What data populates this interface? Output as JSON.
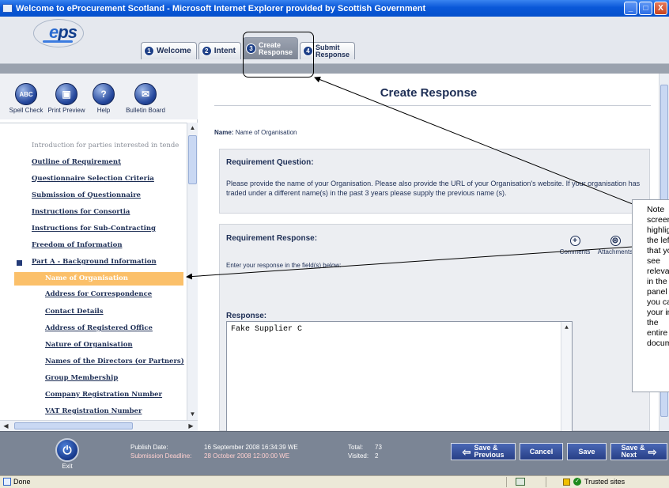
{
  "window": {
    "title": "Welcome to eProcurement Scotland - Microsoft Internet Explorer provided by Scottish Government",
    "controls": {
      "minimize": "_",
      "maximize": "□",
      "close": "X"
    }
  },
  "logo": {
    "text_a": "e",
    "text_b": "ps"
  },
  "tabs": [
    {
      "num": "1",
      "label": "Welcome"
    },
    {
      "num": "2",
      "label": "Intent"
    },
    {
      "num": "3",
      "line1": "Create",
      "line2": "Response"
    },
    {
      "num": "4",
      "line1": "Submit",
      "line2": "Response"
    }
  ],
  "tools": [
    {
      "label": "Spell Check",
      "glyph": "ABC",
      "icon": "spell-check-icon"
    },
    {
      "label": "Print Preview",
      "glyph": "▣",
      "icon": "print-preview-icon"
    },
    {
      "label": "Help",
      "glyph": "?",
      "icon": "help-icon"
    },
    {
      "label": "Bulletin Board",
      "glyph": "✉",
      "icon": "bulletin-board-icon"
    }
  ],
  "nav": {
    "items": [
      "Introduction for parties interested in tende",
      "Outline of Requirement",
      "Questionnaire Selection Criteria",
      "Submission of Questionnaire",
      "Instructions for Consortia",
      "Instructions for Sub-Contracting",
      "Freedom of Information",
      "Part A - Background Information",
      "Name of Organisation",
      "Address for Correspondence",
      "Contact Details",
      "Address of Registered Office",
      "Nature of Organisation",
      "Names of the Directors (or Partners)",
      "Group Membership",
      "Company Registration Number",
      "VAT Registration Number"
    ]
  },
  "main": {
    "title": "Create Response",
    "name_label": "Name:",
    "name_value": "Name of Organisation",
    "question_title": "Requirement Question:",
    "question_text": "Please provide the name of your Organisation. Please also provide the URL of your Organisation's website. If your organisation has traded under a different name(s) in the past 3 years please supply the previous name (s).",
    "response_box_title": "Requirement Response:",
    "response_hint": "Enter your response in the field(s) below:",
    "comments": "Comments",
    "attachments": "Attachments",
    "response_label": "Response:",
    "response_value": "Fake Supplier C"
  },
  "note": "Note screenshot highlights the left that you see relevant in the panel you can your in the entire document",
  "footer": {
    "exit": "Exit",
    "publish_label": "Publish Date:",
    "publish_value": "16 September 2008 16:34:39 WE",
    "deadline_label": "Submission Deadline:",
    "deadline_value": "28 October 2008 12:00:00 WE",
    "total_label": "Total:",
    "total_value": "73",
    "visited_label": "Visited:",
    "visited_value": "2",
    "buttons": {
      "save_prev_1": "Save &",
      "save_prev_2": "Previous",
      "cancel": "Cancel",
      "save": "Save",
      "save_next_1": "Save &",
      "save_next_2": "Next"
    }
  },
  "status": {
    "done": "Done",
    "zone": "Trusted sites"
  }
}
